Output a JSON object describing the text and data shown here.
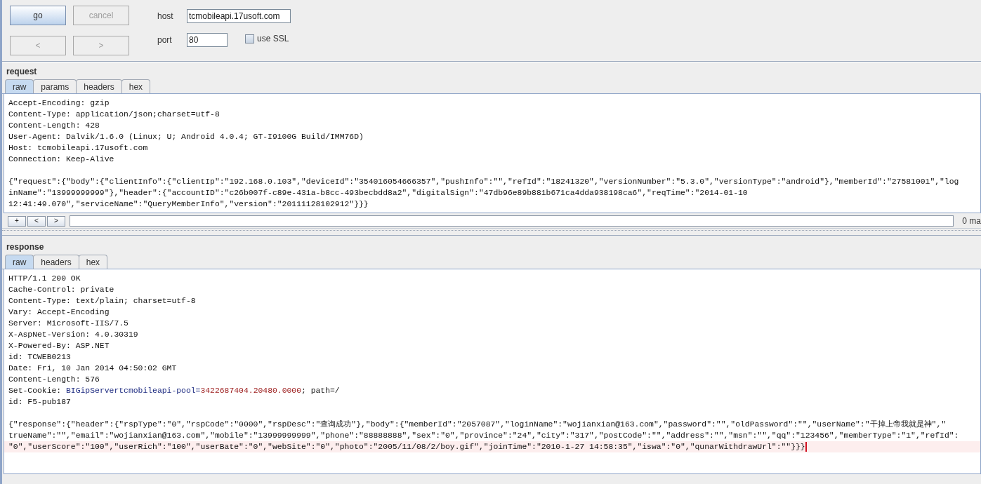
{
  "toolbar": {
    "buttons": [
      {
        "label": "go",
        "disabled": false,
        "default": true
      },
      {
        "label": "cancel",
        "disabled": true,
        "default": false
      },
      {
        "label": "<",
        "disabled": true,
        "default": false
      },
      {
        "label": ">",
        "disabled": true,
        "default": false
      }
    ],
    "host": {
      "label": "host",
      "value": "tcmobileapi.17usoft.com"
    },
    "port": {
      "label": "port",
      "value": "80"
    },
    "ssl": {
      "label": "use SSL",
      "checked": false
    }
  },
  "request": {
    "title": "request",
    "tabs": [
      {
        "label": "raw",
        "selected": true
      },
      {
        "label": "params",
        "selected": false
      },
      {
        "label": "headers",
        "selected": false
      },
      {
        "label": "hex",
        "selected": false
      }
    ],
    "lines": [
      {
        "kind": "text",
        "current": false,
        "parts": [
          {
            "kind": "plain",
            "text": "Accept-Encoding: gzip"
          }
        ]
      },
      {
        "kind": "text",
        "current": false,
        "parts": [
          {
            "kind": "plain",
            "text": "Content-Type: application/json;charset=utf-8"
          }
        ]
      },
      {
        "kind": "text",
        "current": false,
        "parts": [
          {
            "kind": "plain",
            "text": "Content-Length: 428"
          }
        ]
      },
      {
        "kind": "text",
        "current": false,
        "parts": [
          {
            "kind": "plain",
            "text": "User-Agent: Dalvik/1.6.0 (Linux; U; Android 4.0.4; GT-I9100G Build/IMM76D)"
          }
        ]
      },
      {
        "kind": "text",
        "current": false,
        "parts": [
          {
            "kind": "plain",
            "text": "Host: tcmobileapi.17usoft.com"
          }
        ]
      },
      {
        "kind": "text",
        "current": false,
        "parts": [
          {
            "kind": "plain",
            "text": "Connection: Keep-Alive"
          }
        ]
      },
      {
        "kind": "gap"
      },
      {
        "kind": "text",
        "current": false,
        "parts": [
          {
            "kind": "plain",
            "text": "{\"request\":{\"body\":{\"clientInfo\":{\"clientIp\":\"192.168.0.103\",\"deviceId\":\"354016054666357\",\"pushInfo\":\"\",\"refId\":\"18241320\",\"versionNumber\":\"5.3.0\",\"versionType\":\"android\"},\"memberId\":\"27581001\",\"log"
          }
        ]
      },
      {
        "kind": "text",
        "current": false,
        "parts": [
          {
            "kind": "plain",
            "text": "inName\":\"13999999999\"},\"header\":{\"accountID\":\"c26b007f-c89e-431a-b8cc-493becbdd8a2\",\"digitalSign\":\"47db96e89b881b671ca4dda938198ca6\",\"reqTime\":\"2014-01-10"
          }
        ]
      },
      {
        "kind": "text",
        "current": false,
        "parts": [
          {
            "kind": "plain",
            "text": "12:41:49.070\",\"serviceName\":\"QueryMemberInfo\",\"version\":\"20111128102912\"}}}"
          }
        ]
      }
    ],
    "search": {
      "buttons": [
        "+",
        "<",
        ">"
      ],
      "matches": "0 ma"
    }
  },
  "response": {
    "title": "response",
    "tabs": [
      {
        "label": "raw",
        "selected": true
      },
      {
        "label": "headers",
        "selected": false
      },
      {
        "label": "hex",
        "selected": false
      }
    ],
    "lines": [
      {
        "kind": "text",
        "current": false,
        "parts": [
          {
            "kind": "plain",
            "text": "HTTP/1.1 200 OK"
          }
        ]
      },
      {
        "kind": "text",
        "current": false,
        "parts": [
          {
            "kind": "plain",
            "text": "Cache-Control: private"
          }
        ]
      },
      {
        "kind": "text",
        "current": false,
        "parts": [
          {
            "kind": "plain",
            "text": "Content-Type: text/plain; charset=utf-8"
          }
        ]
      },
      {
        "kind": "text",
        "current": false,
        "parts": [
          {
            "kind": "plain",
            "text": "Vary: Accept-Encoding"
          }
        ]
      },
      {
        "kind": "text",
        "current": false,
        "parts": [
          {
            "kind": "plain",
            "text": "Server: Microsoft-IIS/7.5"
          }
        ]
      },
      {
        "kind": "text",
        "current": false,
        "parts": [
          {
            "kind": "plain",
            "text": "X-AspNet-Version: 4.0.30319"
          }
        ]
      },
      {
        "kind": "text",
        "current": false,
        "parts": [
          {
            "kind": "plain",
            "text": "X-Powered-By: ASP.NET"
          }
        ]
      },
      {
        "kind": "text",
        "current": false,
        "parts": [
          {
            "kind": "plain",
            "text": "id: TCWEB0213"
          }
        ]
      },
      {
        "kind": "text",
        "current": false,
        "parts": [
          {
            "kind": "plain",
            "text": "Date: Fri, 10 Jan 2014 04:50:02 GMT"
          }
        ]
      },
      {
        "kind": "text",
        "current": false,
        "parts": [
          {
            "kind": "plain",
            "text": "Content-Length: 576"
          }
        ]
      },
      {
        "kind": "text",
        "current": false,
        "parts": [
          {
            "kind": "plain",
            "text": "Set-Cookie: "
          },
          {
            "kind": "cookie-name",
            "text": "BIGipServertcmobileapi-pool="
          },
          {
            "kind": "cookie-value",
            "text": "3422687404.20480.0000"
          },
          {
            "kind": "plain",
            "text": "; path=/"
          }
        ]
      },
      {
        "kind": "text",
        "current": false,
        "parts": [
          {
            "kind": "plain",
            "text": "id: F5-pub187"
          }
        ]
      },
      {
        "kind": "gap"
      },
      {
        "kind": "text",
        "current": false,
        "parts": [
          {
            "kind": "plain",
            "text": "{\"response\":{\"header\":{\"rspType\":\"0\",\"rspCode\":\"0000\",\"rspDesc\":\"查询成功\"},\"body\":{\"memberId\":\"2057087\",\"loginName\":\"wojianxian@163.com\",\"password\":\"\",\"oldPassword\":\"\",\"userName\":\"干掉上帝我就是神\",\""
          }
        ]
      },
      {
        "kind": "text",
        "current": false,
        "parts": [
          {
            "kind": "plain",
            "text": "trueName\":\"\",\"email\":\"wojianxian@163.com\",\"mobile\":\"13999999999\",\"phone\":\"88888888\",\"sex\":\"0\",\"province\":\"24\",\"city\":\"317\",\"postCode\":\"\",\"address\":\"\",\"msn\":\"\",\"qq\":\"123456\",\"memberType\":\"1\",\"refId\":"
          }
        ]
      },
      {
        "kind": "text",
        "current": true,
        "parts": [
          {
            "kind": "plain",
            "text": "\"0\",\"userScore\":\"100\",\"userRich\":\"100\",\"userBate\":\"0\",\"webSite\":\"0\",\"photo\":\"2005/11/08/2/boy.gif\",\"joinTime\":\"2010-1-27 14:58:35\",\"iswa\":\"0\",\"qunarWithdrawUrl\":\"\"}}}"
          }
        ]
      }
    ]
  }
}
